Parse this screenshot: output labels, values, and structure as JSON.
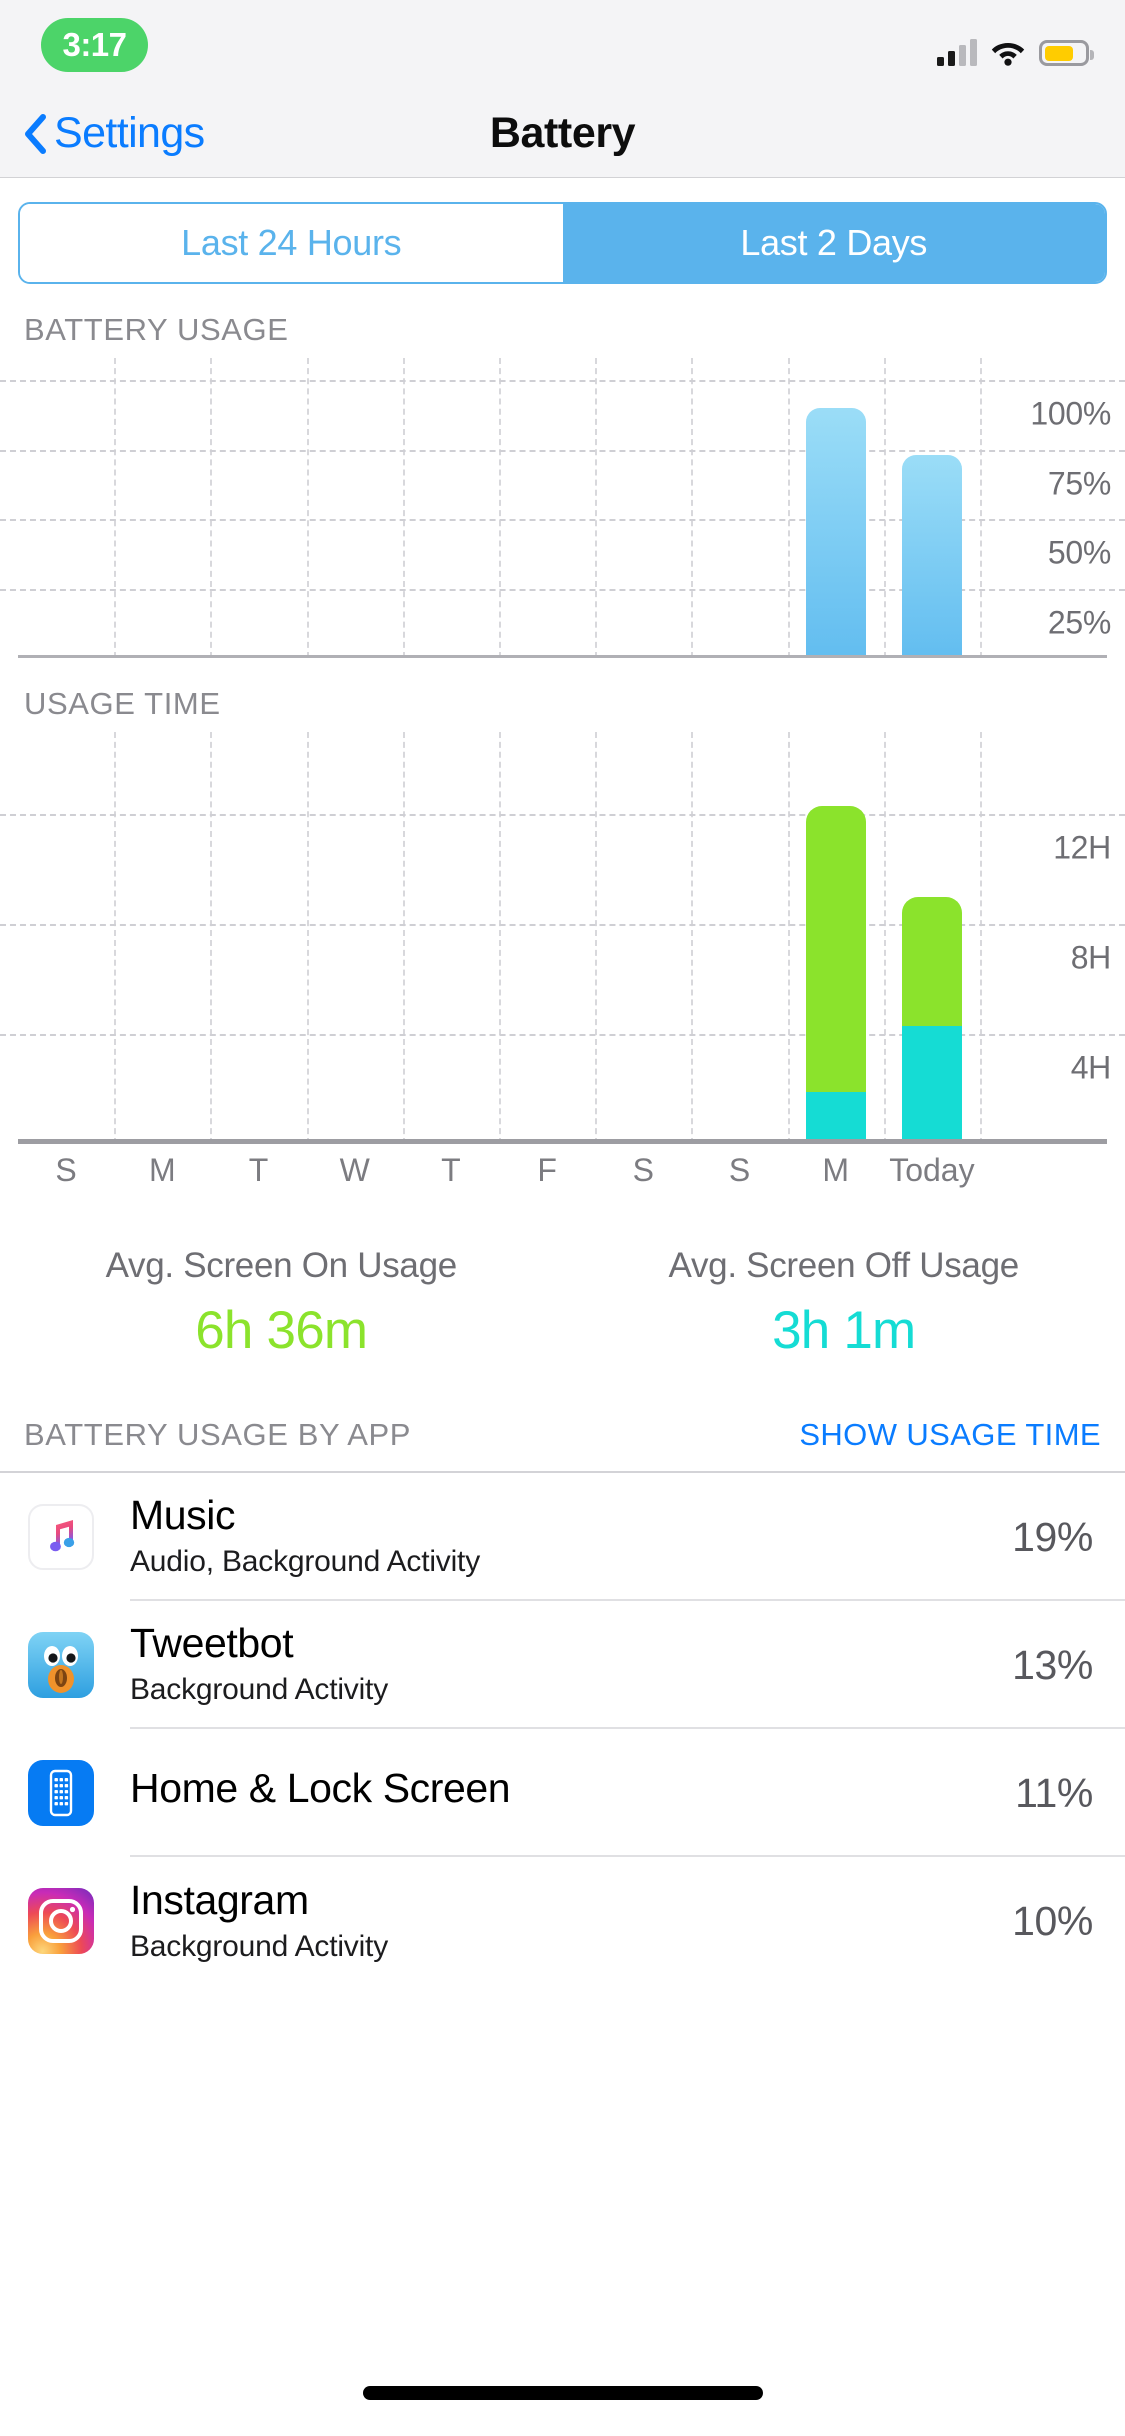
{
  "status_bar": {
    "time": "3:17",
    "time_pill_color": "#4CD469",
    "signal_icon": "cellular-bars-icon",
    "wifi_icon": "wifi-icon",
    "battery_icon": "battery-icon",
    "battery_color": "#FFCC00"
  },
  "nav": {
    "back_label": "Settings",
    "back_icon": "chevron-left-icon",
    "title": "Battery"
  },
  "segmented": {
    "options": [
      {
        "label": "Last 24 Hours",
        "selected": false
      },
      {
        "label": "Last 2 Days",
        "selected": true
      }
    ],
    "accent_color": "#5AB3EC"
  },
  "battery_usage": {
    "label": "BATTERY USAGE"
  },
  "usage_time": {
    "label": "USAGE TIME"
  },
  "averages": {
    "screen_on": {
      "title": "Avg. Screen On Usage",
      "value": "6h 36m",
      "color": "#8BE32C"
    },
    "screen_off": {
      "title": "Avg. Screen Off Usage",
      "value": "3h 1m",
      "color": "#15DCD4"
    }
  },
  "app_list": {
    "header_title": "BATTERY USAGE BY APP",
    "header_action": "SHOW USAGE TIME",
    "rows": [
      {
        "name": "Music",
        "subtitle": "Audio, Background Activity",
        "percent": "19%",
        "icon": "music-app-icon"
      },
      {
        "name": "Tweetbot",
        "subtitle": "Background Activity",
        "percent": "13%",
        "icon": "tweetbot-app-icon"
      },
      {
        "name": "Home & Lock Screen",
        "subtitle": "",
        "percent": "11%",
        "icon": "home-lock-screen-icon"
      },
      {
        "name": "Instagram",
        "subtitle": "Background Activity",
        "percent": "10%",
        "icon": "instagram-app-icon"
      }
    ]
  },
  "chart_data": [
    {
      "type": "bar",
      "title": "BATTERY USAGE",
      "categories": [
        "S",
        "M",
        "T",
        "W",
        "T",
        "F",
        "S",
        "S",
        "M",
        "Today"
      ],
      "values": [
        0,
        0,
        0,
        0,
        0,
        0,
        0,
        0,
        90,
        73
      ],
      "ytick_labels": [
        "100%",
        "75%",
        "50%",
        "25%"
      ],
      "ytick_values": [
        100,
        75,
        50,
        25
      ],
      "ylim": [
        0,
        108
      ],
      "xlabel": "",
      "ylabel": "",
      "grid": true,
      "legend": "none",
      "bar_color": "#62BDF0"
    },
    {
      "type": "bar",
      "title": "USAGE TIME",
      "stacked": true,
      "categories": [
        "S",
        "M",
        "T",
        "W",
        "T",
        "F",
        "S",
        "S",
        "M",
        "Today"
      ],
      "series": [
        {
          "name": "Screen Off",
          "color": "#15DCD4",
          "values": [
            0,
            0,
            0,
            0,
            0,
            0,
            0,
            0,
            1.9,
            4.3
          ]
        },
        {
          "name": "Screen On",
          "color": "#8BE32C",
          "values": [
            0,
            0,
            0,
            0,
            0,
            0,
            0,
            0,
            10.4,
            4.7
          ]
        }
      ],
      "ytick_labels": [
        "12H",
        "8H",
        "4H"
      ],
      "ytick_values": [
        12,
        8,
        4
      ],
      "ylim": [
        0,
        15
      ],
      "xlabel": "",
      "ylabel": "",
      "grid": true,
      "legend": "none"
    }
  ]
}
